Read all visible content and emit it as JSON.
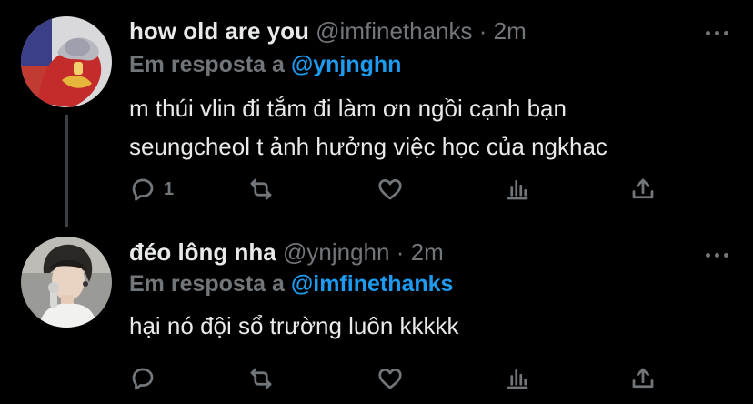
{
  "tweets": [
    {
      "display_name": "how old are you",
      "handle": "@imfinethanks",
      "separator": "·",
      "time": "2m",
      "reply_label": "Em resposta a",
      "reply_mention": "@ynjnghn",
      "text_lines": [
        "m thúi vlin đi tắm đi làm ơn ngồi cạnh bạn",
        "seungcheol t ảnh hưởng việc học của ngkhac"
      ],
      "reply_count": "1",
      "retweet_count": "",
      "like_count": ""
    },
    {
      "display_name": "đéo lông nha",
      "handle": "@ynjnghn",
      "separator": "·",
      "time": "2m",
      "reply_label": "Em resposta a",
      "reply_mention": "@imfinethanks",
      "text_lines": [
        "hại nó đội sổ trường luôn kkkkk"
      ],
      "reply_count": "",
      "retweet_count": "",
      "like_count": ""
    }
  ],
  "colors": {
    "background": "#000000",
    "text_primary": "#e7e9ea",
    "text_secondary": "#71767b",
    "accent": "#1d9bf0",
    "thread_line": "#3b4046"
  },
  "icons": [
    "reply-icon",
    "retweet-icon",
    "like-icon",
    "analytics-icon",
    "share-icon",
    "more-icon"
  ]
}
